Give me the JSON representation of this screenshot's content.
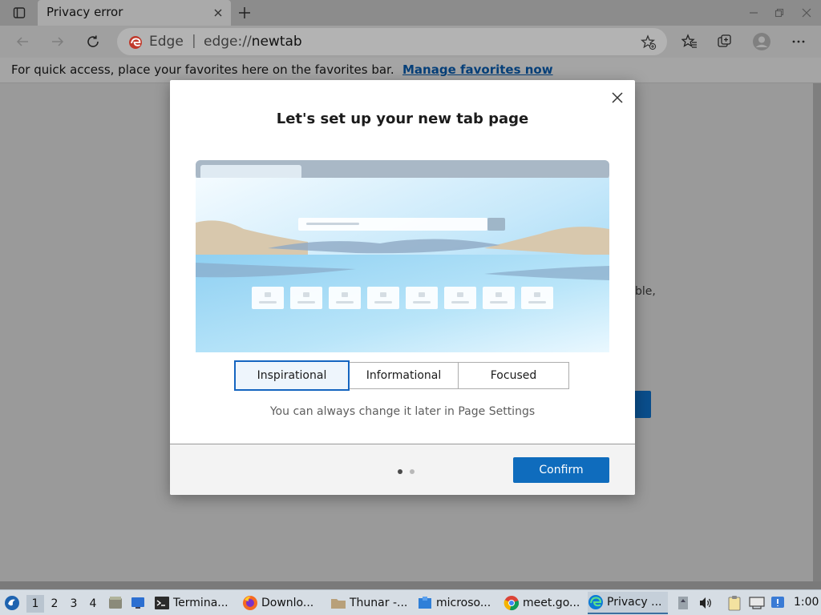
{
  "browser": {
    "tab": {
      "title": "Privacy error"
    },
    "address": {
      "brand": "Edge",
      "separator": "|",
      "url_scheme": "edge://",
      "url_host": "newtab"
    },
    "favorites_bar": {
      "text": "For quick access, place your favorites here on the favorites bar.",
      "link": "Manage favorites now"
    }
  },
  "background_page": {
    "partial_text": "ble,"
  },
  "dialog": {
    "title": "Let's set up your new tab page",
    "options": [
      "Inspirational",
      "Informational",
      "Focused"
    ],
    "selected_option": "Inspirational",
    "hint": "You can always change it later in Page Settings",
    "pagination": {
      "current": 1,
      "total": 2
    },
    "confirm_label": "Confirm"
  },
  "taskbar": {
    "workspaces": [
      "1",
      "2",
      "3",
      "4"
    ],
    "active_workspace": "1",
    "tasks": [
      {
        "label": "Termina...",
        "icon": "terminal-icon"
      },
      {
        "label": "Downlo...",
        "icon": "firefox-icon"
      },
      {
        "label": "Thunar -...",
        "icon": "folder-icon"
      },
      {
        "label": "microso...",
        "icon": "package-icon"
      },
      {
        "label": "meet.go...",
        "icon": "chrome-icon"
      },
      {
        "label": "Privacy ...",
        "icon": "edge-icon"
      }
    ],
    "clock": "1:00"
  },
  "colors": {
    "accent": "#0f6cbd",
    "link": "#06407a",
    "selected_border": "#1565c0"
  }
}
